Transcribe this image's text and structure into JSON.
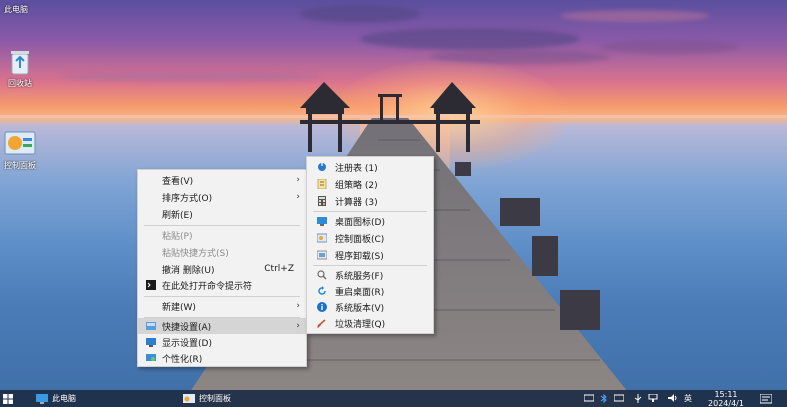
{
  "desktop": {
    "top_label": "此电脑",
    "icons": [
      {
        "label": "回收站",
        "icon": "recycle-bin-icon"
      },
      {
        "label": "控制面板",
        "icon": "control-panel-icon"
      }
    ]
  },
  "context_menu": {
    "items": [
      {
        "label": "查看(V)",
        "has_submenu": true
      },
      {
        "label": "排序方式(O)",
        "has_submenu": true
      },
      {
        "label": "刷新(E)"
      },
      {
        "label": "粘贴(P)",
        "disabled": true
      },
      {
        "label": "粘贴快捷方式(S)",
        "disabled": true
      },
      {
        "label": "撤消 删除(U)",
        "shortcut": "Ctrl+Z"
      },
      {
        "label": "在此处打开命令提示符",
        "icon": "command-prompt-icon"
      },
      {
        "label": "新建(W)",
        "has_submenu": true
      },
      {
        "label": "快捷设置(A)",
        "has_submenu": true,
        "icon": "quick-settings-icon",
        "highlighted": true
      },
      {
        "label": "显示设置(D)",
        "icon": "display-settings-icon"
      },
      {
        "label": "个性化(R)",
        "icon": "personalize-icon"
      }
    ]
  },
  "submenu": {
    "items": [
      {
        "label": "注册表  (1)",
        "icon": "registry-icon"
      },
      {
        "label": "组策略  (2)",
        "icon": "group-policy-icon"
      },
      {
        "label": "计算器  (3)",
        "icon": "calculator-icon"
      },
      {
        "label": "桌面图标(D)",
        "icon": "desktop-icons-icon"
      },
      {
        "label": "控制面板(C)",
        "icon": "control-panel-icon"
      },
      {
        "label": "程序卸载(S)",
        "icon": "uninstall-icon"
      },
      {
        "label": "系统服务(F)",
        "icon": "services-icon"
      },
      {
        "label": "重启桌面(R)",
        "icon": "restart-icon"
      },
      {
        "label": "系统版本(V)",
        "icon": "info-icon"
      },
      {
        "label": "垃圾清理(Q)",
        "icon": "cleanup-icon"
      }
    ]
  },
  "taskbar": {
    "items": [
      {
        "label": "此电脑",
        "icon": "this-pc-icon"
      },
      {
        "label": "控制面板",
        "icon": "control-panel-icon"
      }
    ],
    "ime": "英",
    "time": "15:11",
    "date": "2024/4/1"
  }
}
